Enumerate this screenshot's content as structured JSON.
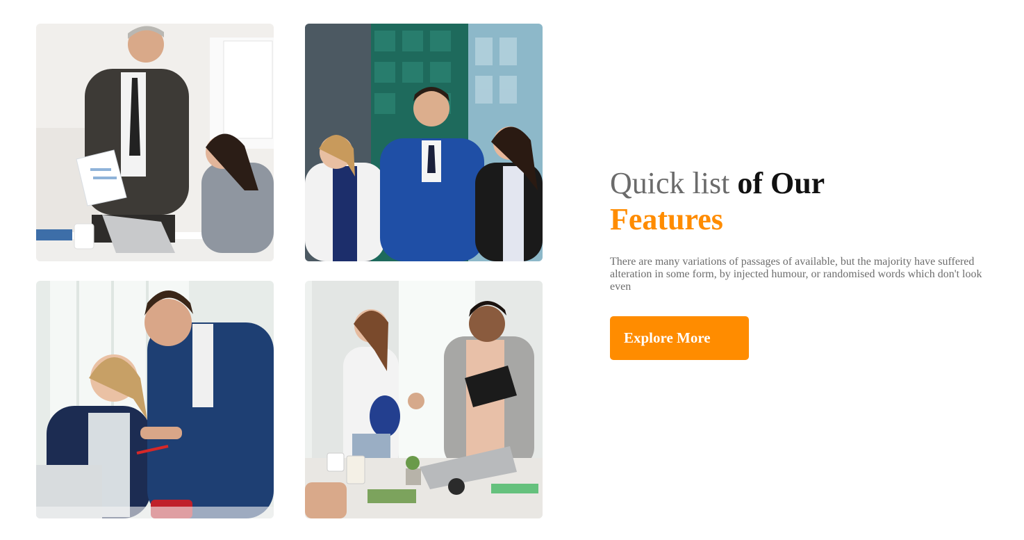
{
  "photos": [
    {
      "name": "photo-senior-manager-reviewing-document",
      "alt": "businessman-photo"
    },
    {
      "name": "photo-team-in-front-of-office-building",
      "alt": "team-photo"
    },
    {
      "name": "photo-colleagues-working-at-laptop",
      "alt": "colleagues-photo"
    },
    {
      "name": "photo-handshake-in-meeting-room",
      "alt": "handshake-photo"
    }
  ],
  "features": {
    "heading_light": "Quick list ",
    "heading_bold": "of Our",
    "heading_accent": "Features",
    "description": "There are many variations of passages of available, but the majority have suffered alteration in some form, by injected humour, or randomised words which don't look even",
    "button_label": "Explore More"
  },
  "colors": {
    "accent": "#ff8c00",
    "heading_dark": "#111111",
    "heading_light": "#6b6b6b",
    "body_text": "#6d6d6d"
  }
}
